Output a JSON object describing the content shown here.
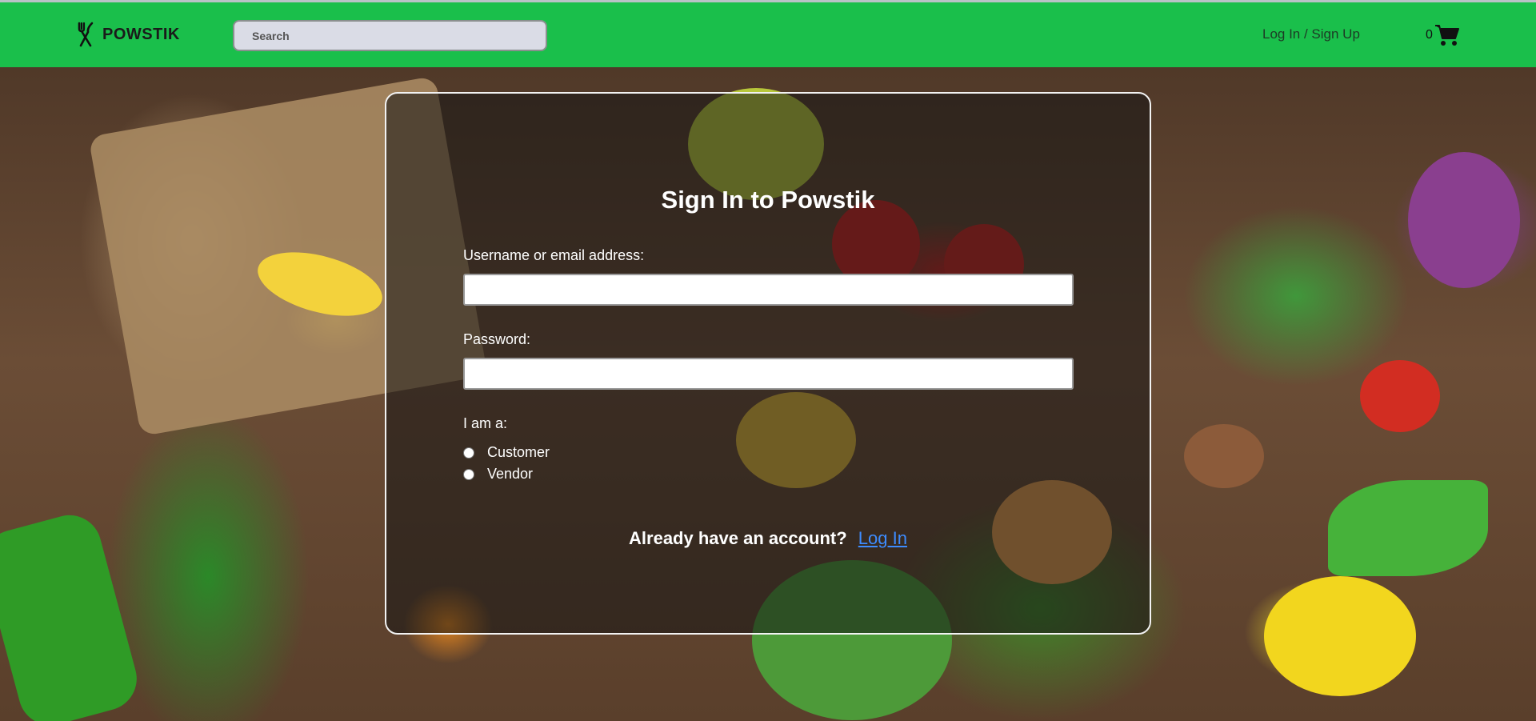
{
  "header": {
    "brand": "POWSTIK",
    "search_placeholder": "Search",
    "auth_link": "Log In / Sign Up",
    "cart_count": "0"
  },
  "signin": {
    "title": "Sign In to Powstik",
    "username_label": "Username or email address:",
    "password_label": "Password:",
    "role_label": "I am a:",
    "roles": [
      "Customer",
      "Vendor"
    ],
    "account_prompt": "Already have an account?",
    "login_link": "Log In"
  },
  "colors": {
    "navbar": "#1abf4b",
    "link": "#3d8cff"
  },
  "icons": {
    "brand": "fork-knife-icon",
    "cart": "shopping-cart-icon"
  }
}
